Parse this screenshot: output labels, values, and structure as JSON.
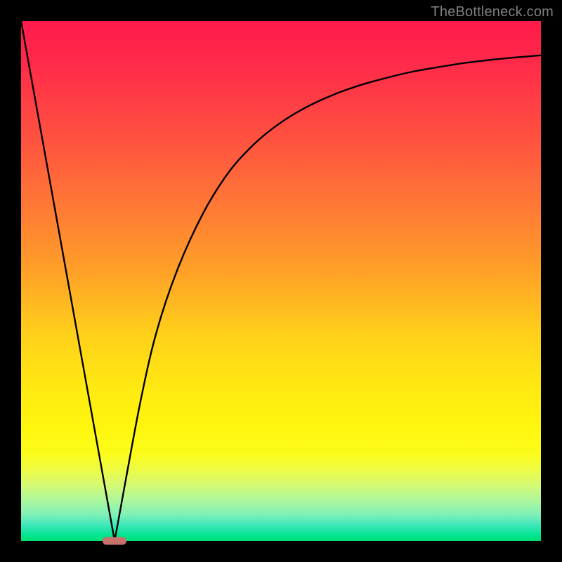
{
  "watermark": {
    "text": "TheBottleneck.com"
  },
  "colors": {
    "frame": "#000000",
    "watermark": "#7f7f7f",
    "curve": "#000000",
    "marker": "#c9726b",
    "gradient_stops": [
      "#ff1a4b",
      "#ff2a4a",
      "#ff5040",
      "#ff7a35",
      "#ffa028",
      "#ffcf1a",
      "#ffe812",
      "#fff60e",
      "#fcfc1a",
      "#f0fb40",
      "#d8fa70",
      "#b0f79a",
      "#7ef0b8",
      "#3ce7ba",
      "#00e490",
      "#00e070"
    ]
  },
  "chart_data": {
    "type": "line",
    "title": "",
    "xlabel": "",
    "ylabel": "",
    "xlim": [
      0,
      100
    ],
    "ylim": [
      0,
      100
    ],
    "grid": false,
    "legend": false,
    "description": "Bottleneck-style curve: a straight line descending from the top-left to a minimum near x≈18, then a convex rise that asymptotically approaches the top toward the right.",
    "series": [
      {
        "name": "main-curve",
        "x": [
          0,
          5,
          10,
          15,
          18,
          20,
          23,
          26,
          30,
          35,
          40,
          45,
          50,
          55,
          60,
          65,
          70,
          75,
          80,
          85,
          90,
          95,
          100
        ],
        "values": [
          100,
          72,
          44,
          17,
          0,
          11,
          27,
          40,
          52,
          63,
          71,
          76.5,
          80.5,
          83.5,
          85.8,
          87.6,
          89,
          90.2,
          91.1,
          91.9,
          92.5,
          93,
          93.4
        ]
      }
    ],
    "marker": {
      "x": 18,
      "y": 0
    }
  }
}
